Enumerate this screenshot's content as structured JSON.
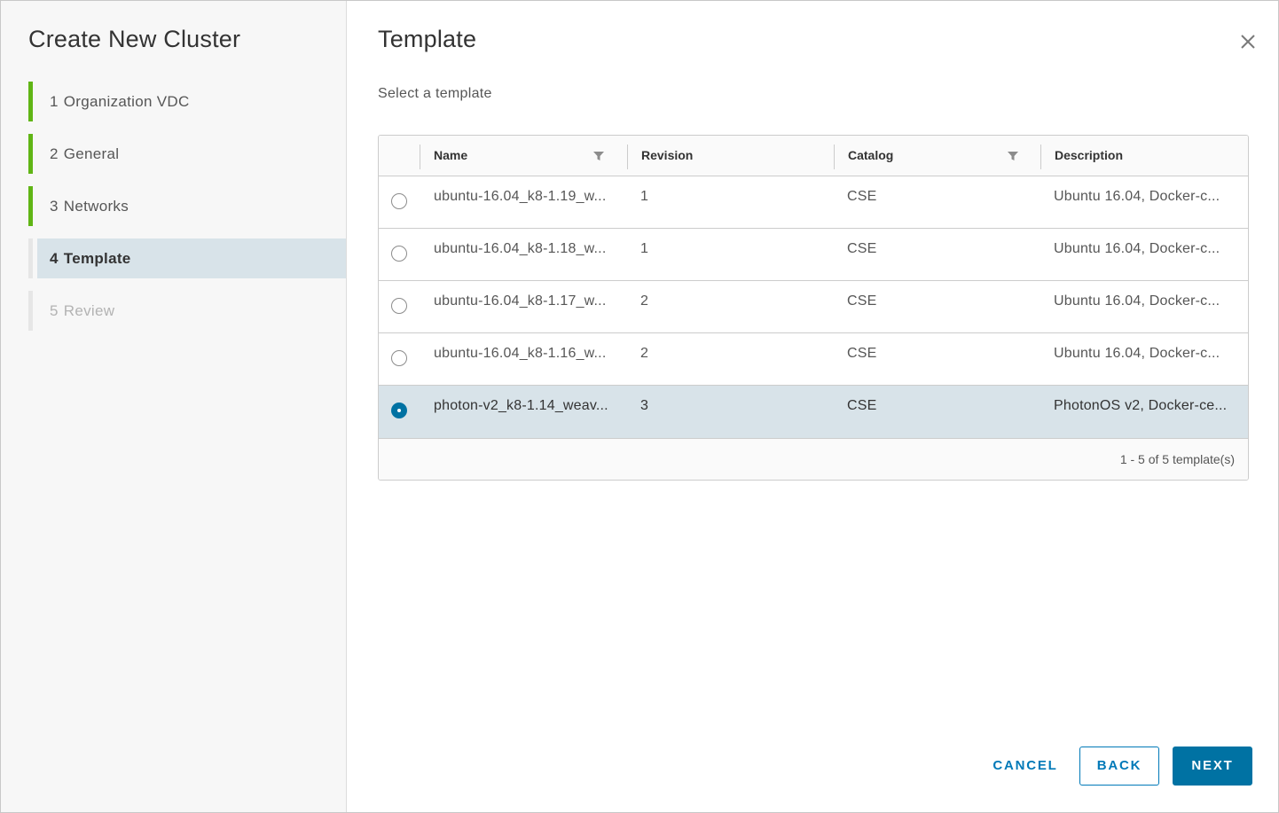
{
  "wizard": {
    "title": "Create New Cluster",
    "steps": [
      {
        "number": "1",
        "label": "Organization VDC",
        "state": "completed"
      },
      {
        "number": "2",
        "label": "General",
        "state": "completed"
      },
      {
        "number": "3",
        "label": "Networks",
        "state": "completed"
      },
      {
        "number": "4",
        "label": "Template",
        "state": "active"
      },
      {
        "number": "5",
        "label": "Review",
        "state": "future"
      }
    ]
  },
  "main": {
    "title": "Template",
    "subtitle": "Select a template",
    "close_icon": "close-icon"
  },
  "grid": {
    "columns": [
      {
        "label": "Name",
        "filterable": true
      },
      {
        "label": "Revision",
        "filterable": false
      },
      {
        "label": "Catalog",
        "filterable": true
      },
      {
        "label": "Description",
        "filterable": false
      }
    ],
    "rows": [
      {
        "name": "ubuntu-16.04_k8-1.19_w...",
        "revision": "1",
        "catalog": "CSE",
        "description": "Ubuntu 16.04, Docker-c...",
        "selected": false
      },
      {
        "name": "ubuntu-16.04_k8-1.18_w...",
        "revision": "1",
        "catalog": "CSE",
        "description": "Ubuntu 16.04, Docker-c...",
        "selected": false
      },
      {
        "name": "ubuntu-16.04_k8-1.17_w...",
        "revision": "2",
        "catalog": "CSE",
        "description": "Ubuntu 16.04, Docker-c...",
        "selected": false
      },
      {
        "name": "ubuntu-16.04_k8-1.16_w...",
        "revision": "2",
        "catalog": "CSE",
        "description": "Ubuntu 16.04, Docker-c...",
        "selected": false
      },
      {
        "name": "photon-v2_k8-1.14_weav...",
        "revision": "3",
        "catalog": "CSE",
        "description": "PhotonOS v2, Docker-ce...",
        "selected": true
      }
    ],
    "footer": "1 - 5 of 5 template(s)"
  },
  "buttons": {
    "cancel": "CANCEL",
    "back": "BACK",
    "next": "NEXT"
  },
  "colors": {
    "accent": "#0072a3",
    "completed_step": "#60b515",
    "selected_row": "#d8e3e9"
  }
}
